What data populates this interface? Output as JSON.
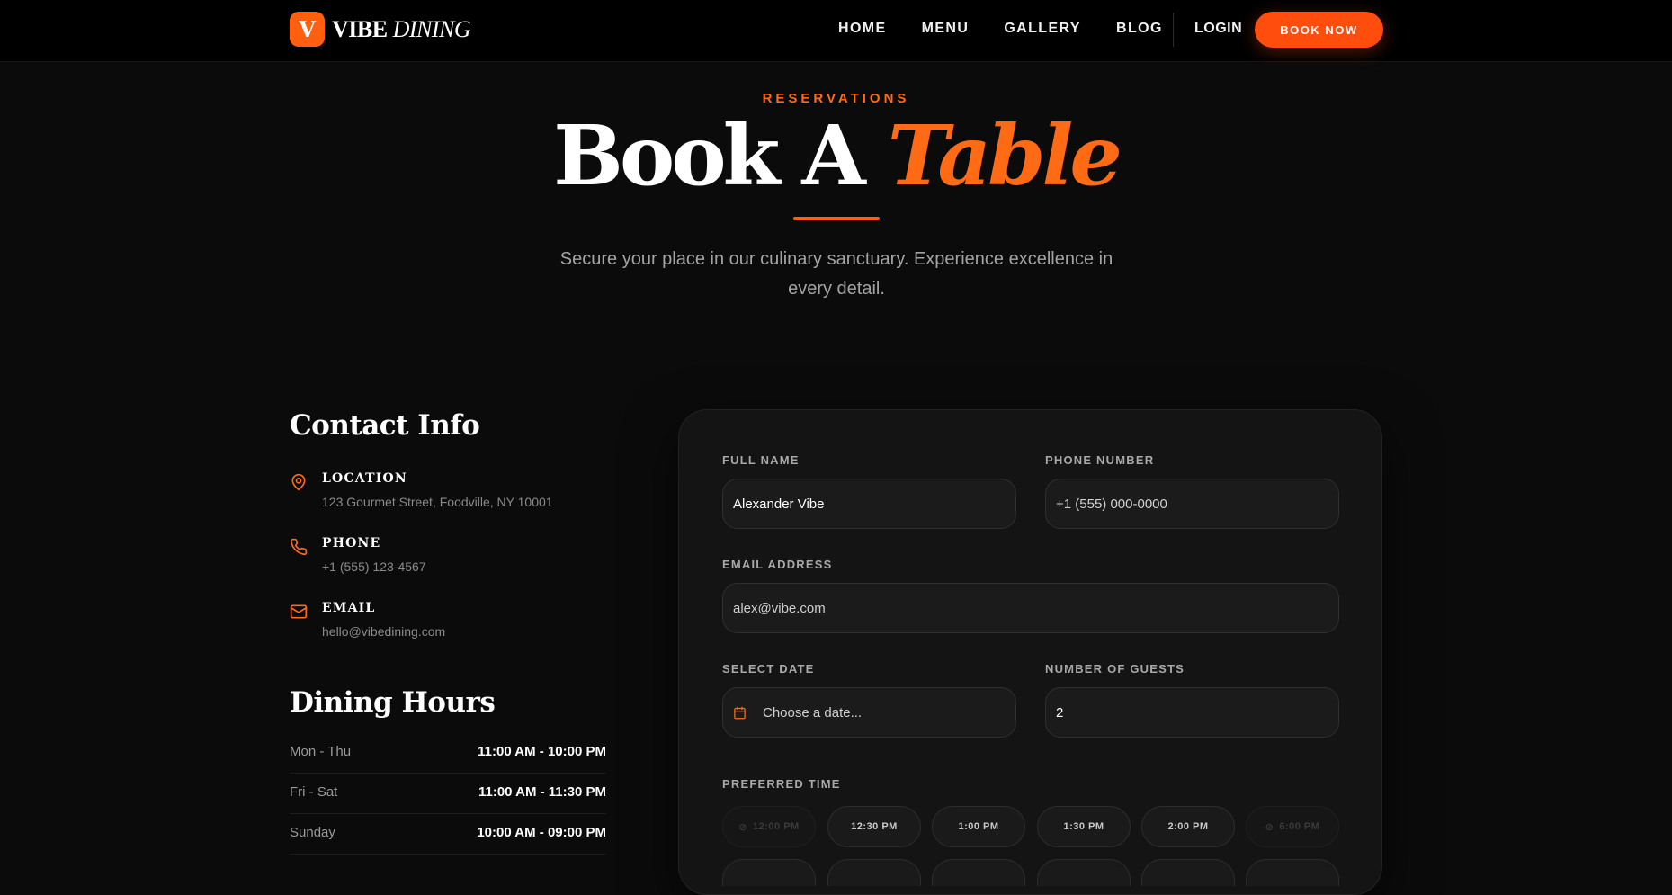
{
  "nav": {
    "logo_letter": "V",
    "brand_bold": "VIBE",
    "brand_italic": "DINING",
    "links": [
      "HOME",
      "MENU",
      "GALLERY",
      "BLOG"
    ],
    "login": "LOGIN",
    "cta": "BOOK NOW"
  },
  "hero": {
    "eyebrow": "RESERVATIONS",
    "title_main": "Book A",
    "title_accent": "Table",
    "subtitle": "Secure your place in our culinary sanctuary. Experience excellence in every detail."
  },
  "contact": {
    "heading": "Contact Info",
    "items": [
      {
        "icon": "map-pin-icon",
        "label": "LOCATION",
        "value": "123 Gourmet Street, Foodville, NY 10001"
      },
      {
        "icon": "phone-icon",
        "label": "PHONE",
        "value": "+1 (555) 123-4567"
      },
      {
        "icon": "mail-icon",
        "label": "EMAIL",
        "value": "hello@vibedining.com"
      }
    ]
  },
  "hours": {
    "heading": "Dining Hours",
    "rows": [
      {
        "day": "Mon - Thu",
        "time": "11:00 AM - 10:00 PM"
      },
      {
        "day": "Fri - Sat",
        "time": "11:00 AM - 11:30 PM"
      },
      {
        "day": "Sunday",
        "time": "10:00 AM - 09:00 PM"
      }
    ]
  },
  "form": {
    "full_name": {
      "label": "FULL NAME",
      "value": "Alexander Vibe"
    },
    "phone": {
      "label": "PHONE NUMBER",
      "value": "+1 (555) 000-0000"
    },
    "email": {
      "label": "EMAIL ADDRESS",
      "value": "alex@vibe.com"
    },
    "date": {
      "label": "SELECT DATE",
      "placeholder": "Choose a date..."
    },
    "guests": {
      "label": "NUMBER OF GUESTS",
      "value": "2"
    },
    "time": {
      "label": "PREFERRED TIME",
      "slots": [
        {
          "time": "12:00 PM",
          "disabled": true
        },
        {
          "time": "12:30 PM",
          "disabled": false
        },
        {
          "time": "1:00 PM",
          "disabled": false
        },
        {
          "time": "1:30 PM",
          "disabled": false
        },
        {
          "time": "2:00 PM",
          "disabled": false
        },
        {
          "time": "6:00 PM",
          "disabled": true
        }
      ]
    }
  },
  "colors": {
    "accent": "#ff6a14",
    "background": "#0b0b0b",
    "card": "#141414"
  }
}
